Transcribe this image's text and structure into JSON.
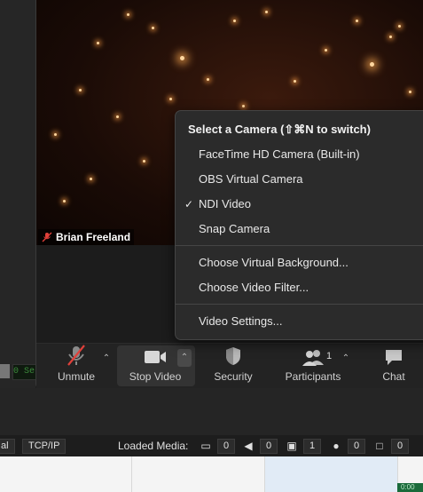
{
  "participant_name": "Brian Freeland",
  "camera_menu": {
    "header": "Select a Camera (⇧⌘N to switch)",
    "cameras": [
      {
        "label": "FaceTime HD Camera (Built-in)",
        "selected": false
      },
      {
        "label": "OBS Virtual Camera",
        "selected": false
      },
      {
        "label": "NDI Video",
        "selected": true
      },
      {
        "label": "Snap Camera",
        "selected": false
      }
    ],
    "check_mark": "✓",
    "options": [
      {
        "label": "Choose Virtual Background..."
      },
      {
        "label": "Choose Video Filter..."
      }
    ],
    "settings": "Video Settings..."
  },
  "toolbar": {
    "unmute": "Unmute",
    "stop_video": "Stop Video",
    "security": "Security",
    "participants": "Participants",
    "participants_count": "1",
    "chat": "Chat"
  },
  "background_app": {
    "left_text": "0 Se",
    "status_bar": {
      "chip_left": "al",
      "chip_tcpip": "TCP/IP",
      "loaded_media_label": "Loaded Media:",
      "counts": {
        "video": "0",
        "audio": "0",
        "image": "1",
        "source": "0",
        "other": "0"
      }
    },
    "green_mark_text": "0:00"
  },
  "colors": {
    "toolbar_bg": "#232323",
    "menu_bg": "#2b2b2b",
    "muted_red": "#e0403a"
  }
}
